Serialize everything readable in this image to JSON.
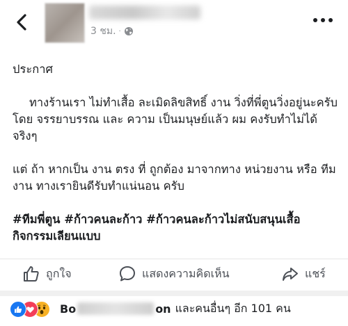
{
  "header": {
    "time": "3 ชม.",
    "separator": "·",
    "privacy_icon": "globe-icon",
    "back_icon": "chevron-left-icon",
    "more_icon": "more-horizontal-icon"
  },
  "post": {
    "title": "ประกาศ",
    "paragraph1": "ทางร้านเรา ไม่ทำเสื้อ ละเมิดลิขสิทธิ์ งาน วิ่งที่พี่ตูนวิ่งอยู่นะครับ    โดย จรรยาบรรณ และ ความ เป็นมนุษย์แล้ว ผม คงรับทำไม่ได้จริงๆ",
    "paragraph2": "แต่ ถ้า หากเป็น งาน ตรง ที่ ถูกต้อง มาจากทาง หน่วยงาน หรือ ทีมงาน ทางเรายินดีรับทำแน่นอน ครับ",
    "hashtags": "#ทีมพี่ตูน #ก้าวคนละก้าว #ก้าวคนละก้าวไม่สนับสนุนเสื้อกิจกรรมเลียนแบบ"
  },
  "actions": {
    "like_label": "ถูกใจ",
    "comment_label": "แสดงความคิดเห็น",
    "share_label": "แชร์",
    "like_icon": "thumbs-up-icon",
    "comment_icon": "comment-bubble-icon",
    "share_icon": "share-arrow-icon"
  },
  "reactions": {
    "icons": [
      "like",
      "love",
      "wow"
    ],
    "name_start": "Bo",
    "name_end": "on",
    "others_text": "และคนอื่นๆ อีก 101 คน",
    "colors": {
      "like": "#1877f2",
      "love": "#f33e58",
      "wow": "#f7b125"
    }
  }
}
